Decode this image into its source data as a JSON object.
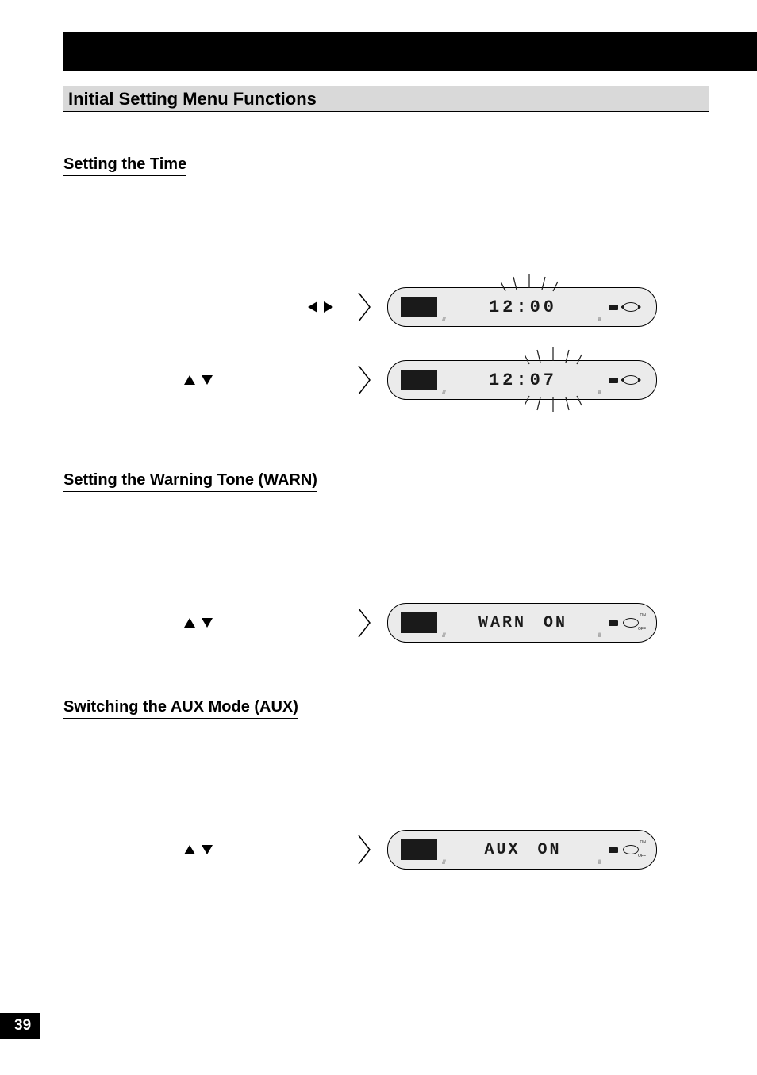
{
  "page_number": "39",
  "section_heading": "Initial Setting Menu Functions",
  "sections": [
    {
      "title": "Setting the Time",
      "rows": [
        {
          "arrows": "lr",
          "display_time": "12:00",
          "burst_on": "hour"
        },
        {
          "arrows": "ud",
          "display_time": "12:07",
          "burst_on": "minute"
        }
      ]
    },
    {
      "title": "Setting the Warning Tone (WARN)",
      "rows": [
        {
          "arrows": "ud",
          "display_label": "WARN",
          "display_value": "ON",
          "onoff": true
        }
      ]
    },
    {
      "title": "Switching the AUX Mode (AUX)",
      "rows": [
        {
          "arrows": "ud",
          "display_label": "AUX",
          "display_value": "ON",
          "onoff": true
        }
      ]
    }
  ]
}
